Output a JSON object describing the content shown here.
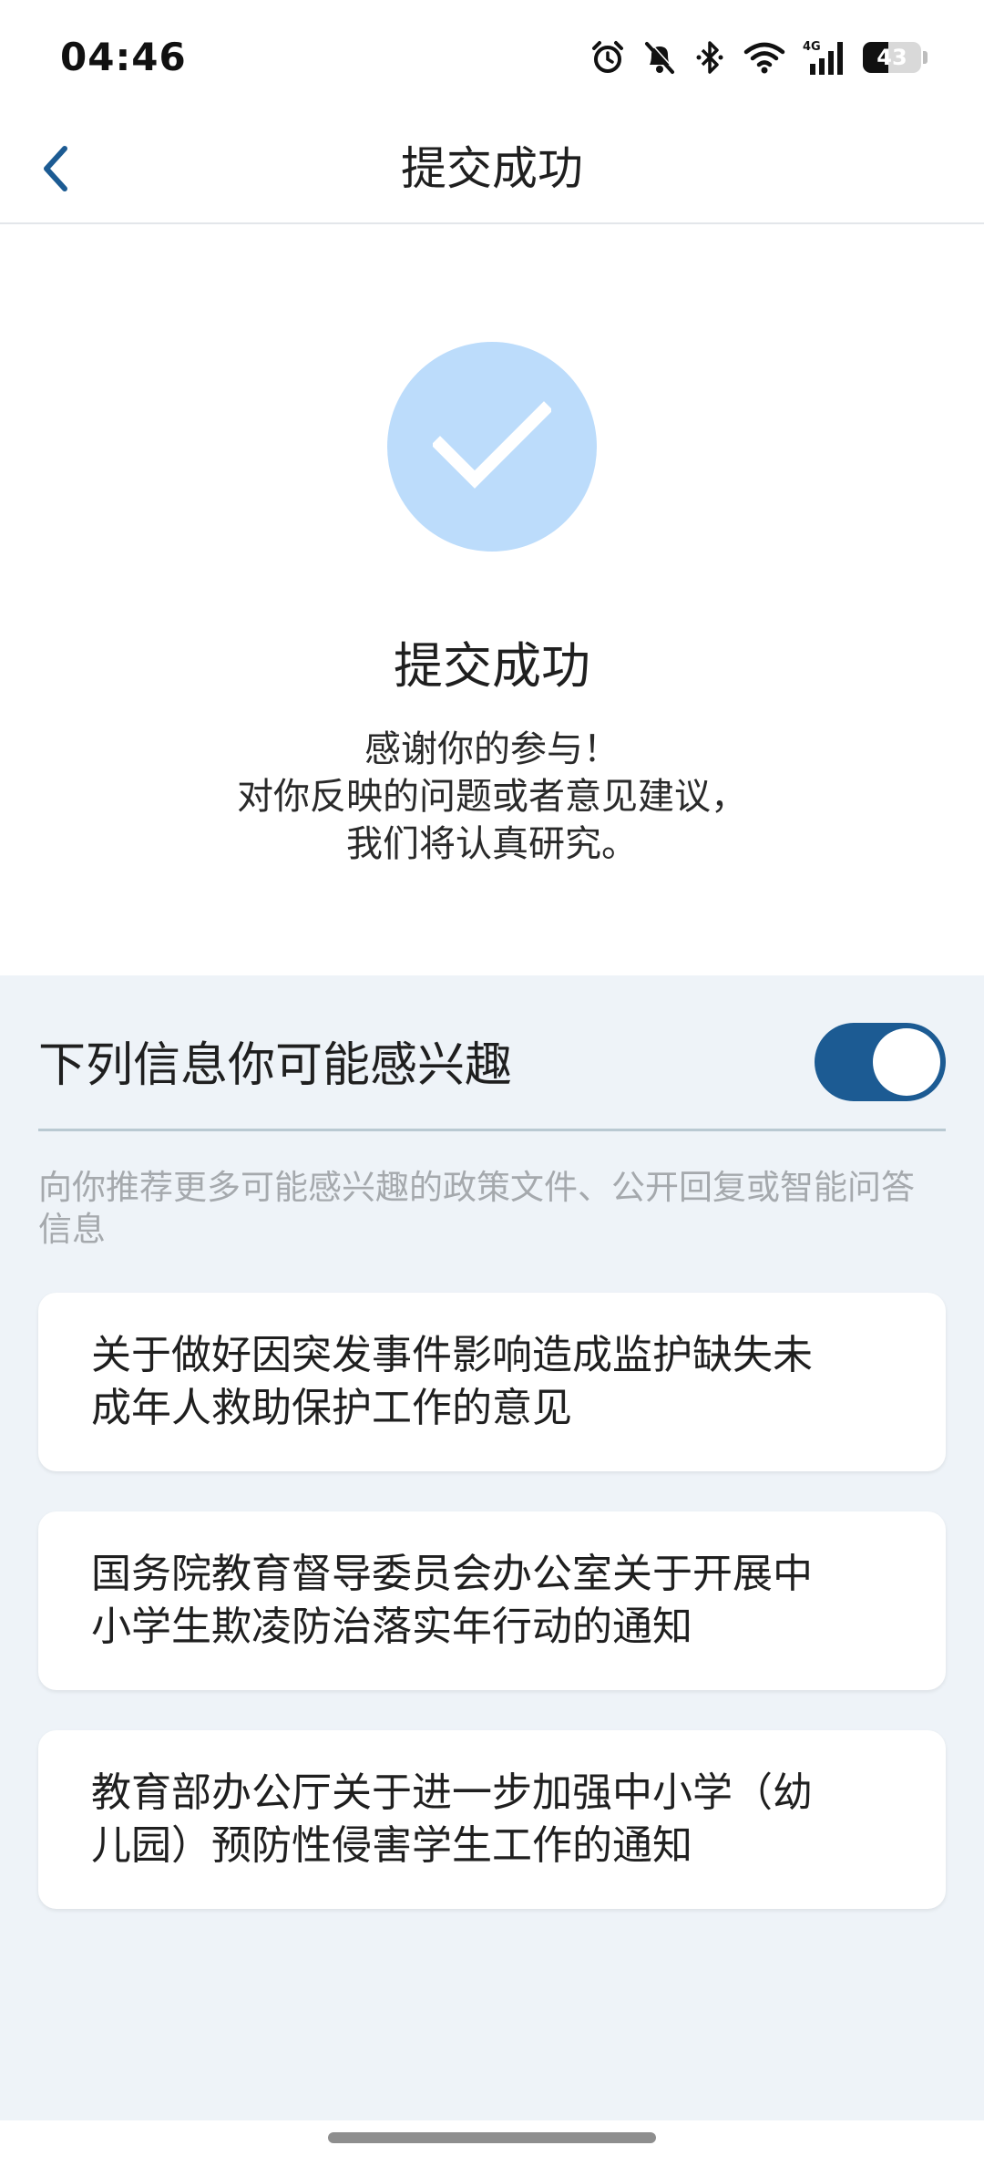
{
  "status_bar": {
    "time": "04:46",
    "battery_text": "43",
    "battery_level": 0.43,
    "icons": [
      "alarm-icon",
      "bell-muted-icon",
      "bluetooth-icon",
      "wifi-icon",
      "signal-4g-icon",
      "battery-icon"
    ],
    "network_label": "4G"
  },
  "nav": {
    "title": "提交成功",
    "back_icon": "chevron-left-icon"
  },
  "success": {
    "icon": "check-icon",
    "title": "提交成功",
    "message_lines": [
      "感谢你的参与！",
      "对你反映的问题或者意见建议，",
      "我们将认真研究。"
    ]
  },
  "recommend": {
    "header": "下列信息你可能感兴趣",
    "toggle_on": true,
    "description": "向你推荐更多可能感兴趣的政策文件、公开回复或智能问答信息",
    "items": [
      {
        "lines": [
          "关于做好因突发事件影响造成监护缺失未",
          "成年人救助保护工作的意见"
        ]
      },
      {
        "lines": [
          "国务院教育督导委员会办公室关于开展中",
          "小学生欺凌防治落实年行动的通知"
        ]
      },
      {
        "lines": [
          "教育部办公厅关于进一步加强中小学（幼",
          "儿园）预防性侵害学生工作的通知"
        ]
      }
    ]
  },
  "colors": {
    "accent": "#1c5b93",
    "check_circle": "#bcdcfb",
    "background": "#eef3f8",
    "muted_text": "#a5a9ad"
  }
}
